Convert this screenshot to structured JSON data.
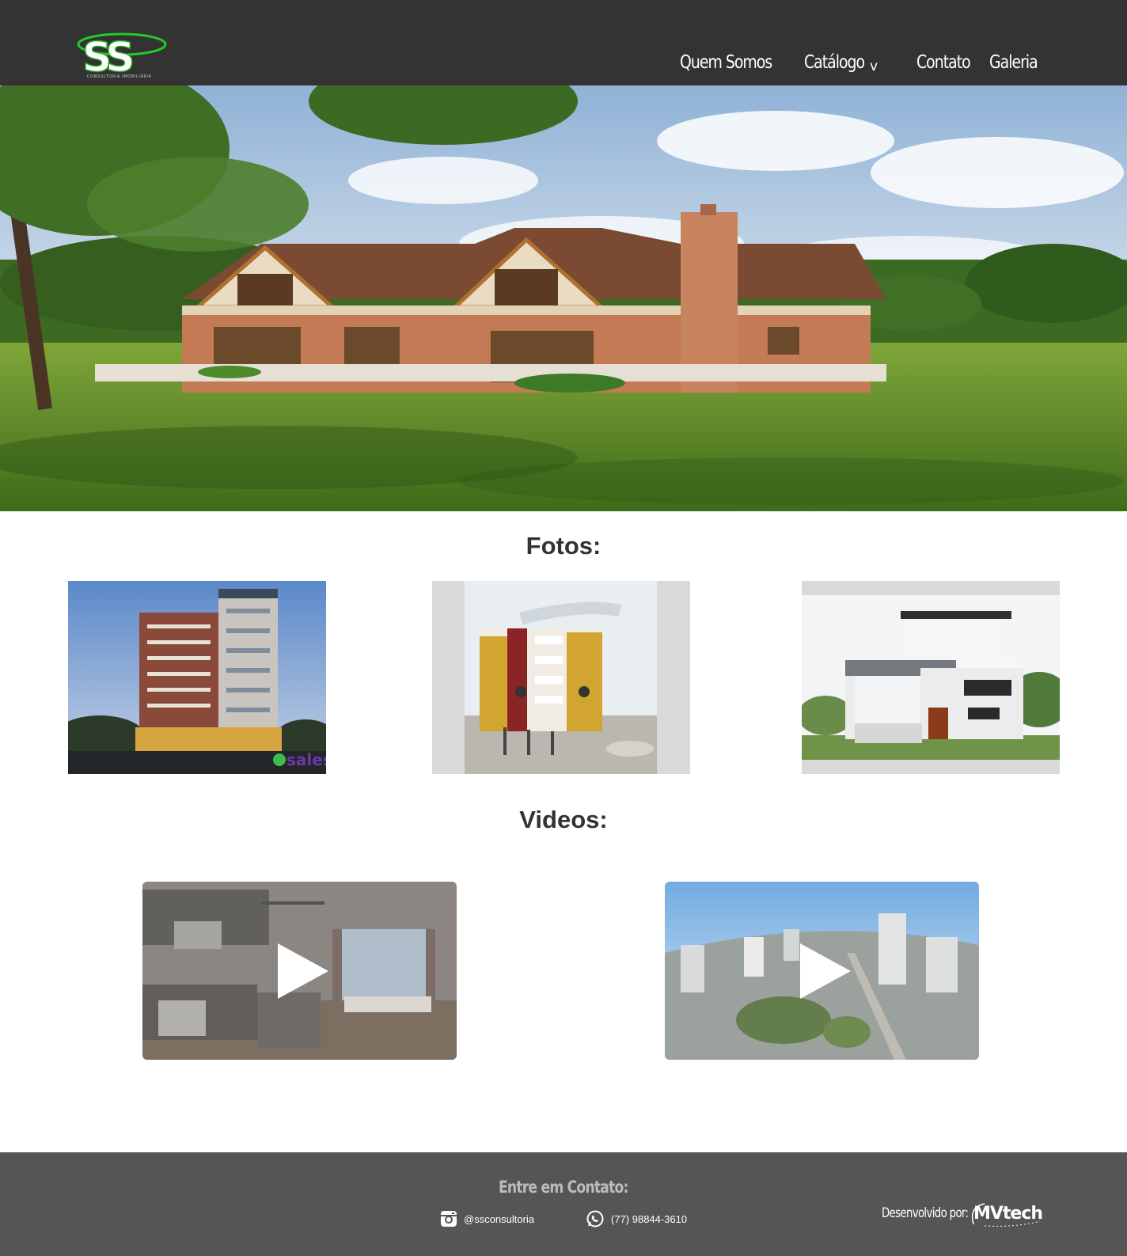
{
  "header": {
    "logo_text": "SS",
    "logo_tagline": "CONSULTORIA IMOBILIÁRIA",
    "nav": {
      "quem_somos": "Quem Somos",
      "catalogo": "Catálogo",
      "catalogo_chevron": "v",
      "contato": "Contato",
      "galeria": "Galeria"
    },
    "colors": {
      "background": "#333333",
      "logo_green": "#22cc22"
    }
  },
  "hero": {
    "image": "country-house-photo"
  },
  "fotos": {
    "title": "Fotos:",
    "items": [
      {
        "image": "apartment-tower-photo",
        "watermark": "sales"
      },
      {
        "image": "modern-building-photo"
      },
      {
        "image": "white-house-photo"
      }
    ]
  },
  "videos": {
    "title": "Videos:",
    "items": [
      {
        "thumbnail": "kitchen-interior-video",
        "icon": "play-icon"
      },
      {
        "thumbnail": "aerial-city-video",
        "icon": "play-icon"
      }
    ]
  },
  "footer": {
    "title": "Entre em Contato:",
    "instagram": {
      "icon": "instagram-icon",
      "handle": "@ssconsultoria"
    },
    "whatsapp": {
      "icon": "whatsapp-icon",
      "phone": "(77) 98844-3610"
    },
    "developed_by": "Desenvolvido por:",
    "developer_logo": "MVtech",
    "colors": {
      "background": "#555555"
    }
  }
}
